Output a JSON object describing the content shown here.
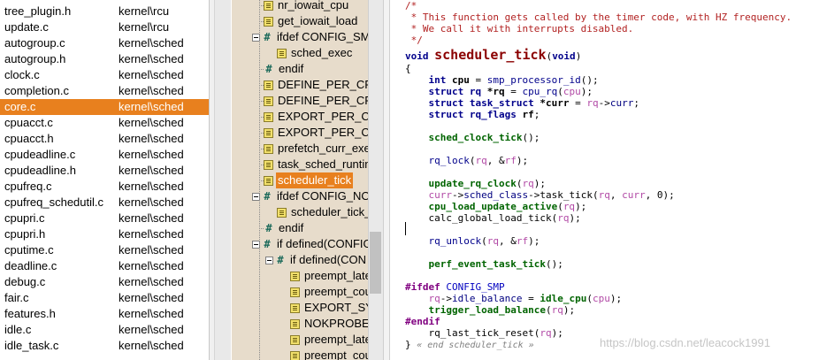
{
  "file_list": [
    {
      "name": "tree_plugin.h",
      "path": "kernel\\rcu",
      "selected": false
    },
    {
      "name": "update.c",
      "path": "kernel\\rcu",
      "selected": false
    },
    {
      "name": "autogroup.c",
      "path": "kernel\\sched",
      "selected": false
    },
    {
      "name": "autogroup.h",
      "path": "kernel\\sched",
      "selected": false
    },
    {
      "name": "clock.c",
      "path": "kernel\\sched",
      "selected": false
    },
    {
      "name": "completion.c",
      "path": "kernel\\sched",
      "selected": false
    },
    {
      "name": "core.c",
      "path": "kernel\\sched",
      "selected": true
    },
    {
      "name": "cpuacct.c",
      "path": "kernel\\sched",
      "selected": false
    },
    {
      "name": "cpuacct.h",
      "path": "kernel\\sched",
      "selected": false
    },
    {
      "name": "cpudeadline.c",
      "path": "kernel\\sched",
      "selected": false
    },
    {
      "name": "cpudeadline.h",
      "path": "kernel\\sched",
      "selected": false
    },
    {
      "name": "cpufreq.c",
      "path": "kernel\\sched",
      "selected": false
    },
    {
      "name": "cpufreq_schedutil.c",
      "path": "kernel\\sched",
      "selected": false
    },
    {
      "name": "cpupri.c",
      "path": "kernel\\sched",
      "selected": false
    },
    {
      "name": "cpupri.h",
      "path": "kernel\\sched",
      "selected": false
    },
    {
      "name": "cputime.c",
      "path": "kernel\\sched",
      "selected": false
    },
    {
      "name": "deadline.c",
      "path": "kernel\\sched",
      "selected": false
    },
    {
      "name": "debug.c",
      "path": "kernel\\sched",
      "selected": false
    },
    {
      "name": "fair.c",
      "path": "kernel\\sched",
      "selected": false
    },
    {
      "name": "features.h",
      "path": "kernel\\sched",
      "selected": false
    },
    {
      "name": "idle.c",
      "path": "kernel\\sched",
      "selected": false
    },
    {
      "name": "idle_task.c",
      "path": "kernel\\sched",
      "selected": false
    }
  ],
  "symbol_tree": [
    {
      "label": "nr_iowait_cpu",
      "icon": "function-icon",
      "level": 0,
      "expander": false,
      "selected": false
    },
    {
      "label": "get_iowait_load",
      "icon": "function-icon",
      "level": 0,
      "expander": false,
      "selected": false
    },
    {
      "label": "ifdef CONFIG_SMP",
      "icon": "preprocessor-icon",
      "level": 0,
      "expander": true,
      "selected": false
    },
    {
      "label": "sched_exec",
      "icon": "function-icon",
      "level": 1,
      "expander": false,
      "selected": false
    },
    {
      "label": "endif",
      "icon": "preprocessor-icon",
      "level": 0,
      "expander": false,
      "selected": false
    },
    {
      "label": "DEFINE_PER_CPU",
      "icon": "function-icon",
      "level": 0,
      "expander": false,
      "selected": false
    },
    {
      "label": "DEFINE_PER_CPU",
      "icon": "function-icon",
      "level": 0,
      "expander": false,
      "selected": false
    },
    {
      "label": "EXPORT_PER_CPU",
      "icon": "function-icon",
      "level": 0,
      "expander": false,
      "selected": false
    },
    {
      "label": "EXPORT_PER_CPU",
      "icon": "function-icon",
      "level": 0,
      "expander": false,
      "selected": false
    },
    {
      "label": "prefetch_curr_exe",
      "icon": "function-icon",
      "level": 0,
      "expander": false,
      "selected": false
    },
    {
      "label": "task_sched_runtim",
      "icon": "function-icon",
      "level": 0,
      "expander": false,
      "selected": false
    },
    {
      "label": "scheduler_tick",
      "icon": "function-icon",
      "level": 0,
      "expander": false,
      "selected": true
    },
    {
      "label": "ifdef CONFIG_NO",
      "icon": "preprocessor-icon",
      "level": 0,
      "expander": true,
      "selected": false
    },
    {
      "label": "scheduler_tick_",
      "icon": "function-icon",
      "level": 1,
      "expander": false,
      "selected": false
    },
    {
      "label": "endif",
      "icon": "preprocessor-icon",
      "level": 0,
      "expander": false,
      "selected": false
    },
    {
      "label": "if defined(CONFIG",
      "icon": "preprocessor-icon",
      "level": 0,
      "expander": true,
      "selected": false
    },
    {
      "label": "if defined(CON",
      "icon": "preprocessor-icon",
      "level": 1,
      "expander": true,
      "selected": false
    },
    {
      "label": "preempt_late",
      "icon": "function-icon",
      "level": 2,
      "expander": false,
      "selected": false
    },
    {
      "label": "preempt_cou",
      "icon": "function-icon",
      "level": 2,
      "expander": false,
      "selected": false
    },
    {
      "label": "EXPORT_SYM",
      "icon": "function-icon",
      "level": 2,
      "expander": false,
      "selected": false
    },
    {
      "label": "NOKPROBE_",
      "icon": "function-icon",
      "level": 2,
      "expander": false,
      "selected": false
    },
    {
      "label": "preempt_late",
      "icon": "function-icon",
      "level": 2,
      "expander": false,
      "selected": false
    },
    {
      "label": "preempt_cou",
      "icon": "function-icon",
      "level": 2,
      "expander": false,
      "selected": false
    }
  ],
  "code_lines": [
    [
      {
        "t": "/*",
        "c": "comment"
      }
    ],
    [
      {
        "t": " * This function gets called by the timer code, with HZ frequency.",
        "c": "comment"
      }
    ],
    [
      {
        "t": " * We call it with interrupts disabled.",
        "c": "comment"
      }
    ],
    [
      {
        "t": " */",
        "c": "comment"
      }
    ],
    [
      {
        "t": "void ",
        "c": "type"
      },
      {
        "t": "scheduler_tick",
        "c": "def"
      },
      {
        "t": "(",
        "c": "plain"
      },
      {
        "t": "void",
        "c": "type"
      },
      {
        "t": ")",
        "c": "plain"
      }
    ],
    [
      {
        "t": "{",
        "c": "plain"
      }
    ],
    [
      {
        "t": "    int ",
        "c": "type"
      },
      {
        "t": "cpu",
        "c": "var"
      },
      {
        "t": " = ",
        "c": "plain"
      },
      {
        "t": "smp_processor_id",
        "c": "fn"
      },
      {
        "t": "();",
        "c": "plain"
      }
    ],
    [
      {
        "t": "    struct rq ",
        "c": "type"
      },
      {
        "t": "*rq",
        "c": "var"
      },
      {
        "t": " = ",
        "c": "plain"
      },
      {
        "t": "cpu_rq",
        "c": "fn"
      },
      {
        "t": "(",
        "c": "plain"
      },
      {
        "t": "cpu",
        "c": "param"
      },
      {
        "t": ");",
        "c": "plain"
      }
    ],
    [
      {
        "t": "    struct task_struct ",
        "c": "type"
      },
      {
        "t": "*curr",
        "c": "var"
      },
      {
        "t": " = ",
        "c": "plain"
      },
      {
        "t": "rq",
        "c": "param"
      },
      {
        "t": "->",
        "c": "plain"
      },
      {
        "t": "curr",
        "c": "mem"
      },
      {
        "t": ";",
        "c": "plain"
      }
    ],
    [
      {
        "t": "    struct rq_flags ",
        "c": "type"
      },
      {
        "t": "rf",
        "c": "var"
      },
      {
        "t": ";",
        "c": "plain"
      }
    ],
    [],
    [
      {
        "t": "    sched_clock_tick",
        "c": "call"
      },
      {
        "t": "();",
        "c": "plain"
      }
    ],
    [],
    [
      {
        "t": "    rq_lock",
        "c": "fn"
      },
      {
        "t": "(",
        "c": "plain"
      },
      {
        "t": "rq",
        "c": "param"
      },
      {
        "t": ", &",
        "c": "plain"
      },
      {
        "t": "rf",
        "c": "param"
      },
      {
        "t": ");",
        "c": "plain"
      }
    ],
    [],
    [
      {
        "t": "    update_rq_clock",
        "c": "call"
      },
      {
        "t": "(",
        "c": "plain"
      },
      {
        "t": "rq",
        "c": "param"
      },
      {
        "t": ");",
        "c": "plain"
      }
    ],
    [
      {
        "t": "    curr",
        "c": "param"
      },
      {
        "t": "->",
        "c": "plain"
      },
      {
        "t": "sched_class",
        "c": "mem"
      },
      {
        "t": "->",
        "c": "plain"
      },
      {
        "t": "task_tick",
        "c": "plain"
      },
      {
        "t": "(",
        "c": "plain"
      },
      {
        "t": "rq",
        "c": "param"
      },
      {
        "t": ", ",
        "c": "plain"
      },
      {
        "t": "curr",
        "c": "param"
      },
      {
        "t": ", 0);",
        "c": "plain"
      }
    ],
    [
      {
        "t": "    cpu_load_update_active",
        "c": "call"
      },
      {
        "t": "(",
        "c": "plain"
      },
      {
        "t": "rq",
        "c": "param"
      },
      {
        "t": ");",
        "c": "plain"
      }
    ],
    [
      {
        "t": "    calc_global_load_tick",
        "c": "plain"
      },
      {
        "t": "(",
        "c": "plain"
      },
      {
        "t": "rq",
        "c": "param"
      },
      {
        "t": ");",
        "c": "plain"
      }
    ],
    [],
    [
      {
        "t": "    rq_unlock",
        "c": "fn"
      },
      {
        "t": "(",
        "c": "plain"
      },
      {
        "t": "rq",
        "c": "param"
      },
      {
        "t": ", &",
        "c": "plain"
      },
      {
        "t": "rf",
        "c": "param"
      },
      {
        "t": ");",
        "c": "plain"
      }
    ],
    [],
    [
      {
        "t": "    perf_event_task_tick",
        "c": "call"
      },
      {
        "t": "();",
        "c": "plain"
      }
    ],
    [],
    [
      {
        "t": "#ifdef ",
        "c": "pp"
      },
      {
        "t": "CONFIG_SMP",
        "c": "macro"
      }
    ],
    [
      {
        "t": "    rq",
        "c": "param"
      },
      {
        "t": "->",
        "c": "plain"
      },
      {
        "t": "idle_balance",
        "c": "mem"
      },
      {
        "t": " = ",
        "c": "plain"
      },
      {
        "t": "idle_cpu",
        "c": "call"
      },
      {
        "t": "(",
        "c": "plain"
      },
      {
        "t": "cpu",
        "c": "param"
      },
      {
        "t": ");",
        "c": "plain"
      }
    ],
    [
      {
        "t": "    trigger_load_balance",
        "c": "call"
      },
      {
        "t": "(",
        "c": "plain"
      },
      {
        "t": "rq",
        "c": "param"
      },
      {
        "t": ");",
        "c": "plain"
      }
    ],
    [
      {
        "t": "#endif",
        "c": "pp"
      }
    ],
    [
      {
        "t": "    rq_last_tick_reset",
        "c": "plain"
      },
      {
        "t": "(",
        "c": "plain"
      },
      {
        "t": "rq",
        "c": "param"
      },
      {
        "t": ");",
        "c": "plain"
      }
    ],
    [
      {
        "t": "} ",
        "c": "plain"
      },
      {
        "t": "« end scheduler_tick »",
        "c": "endmark"
      }
    ]
  ],
  "watermark": "https://blog.csdn.net/leacock1991"
}
